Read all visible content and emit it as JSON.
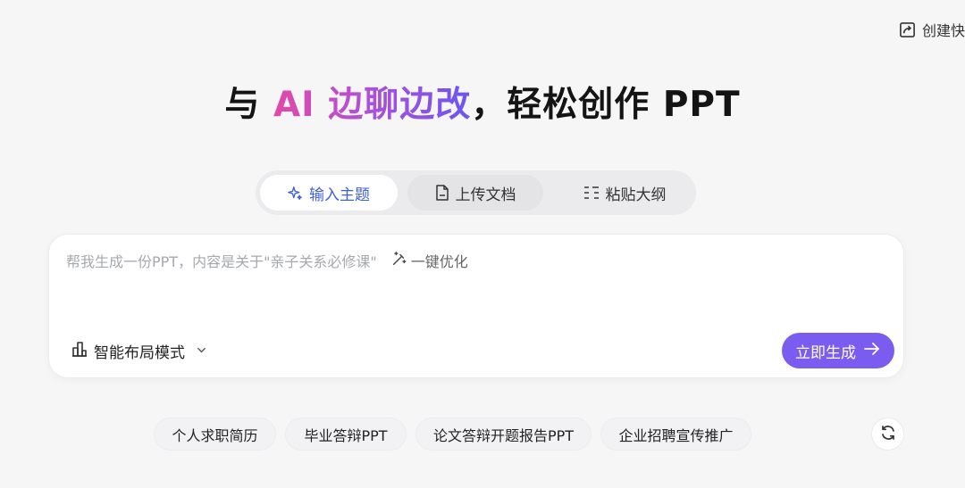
{
  "header": {
    "create_label": "创建快",
    "create_icon": "share-edit-icon"
  },
  "hero": {
    "prefix": "与 ",
    "highlight": "AI 边聊边改",
    "suffix": "，轻松创作 PPT"
  },
  "tabs": [
    {
      "label": "输入主题",
      "icon": "sparkle-icon",
      "active": true
    },
    {
      "label": "上传文档",
      "icon": "document-icon",
      "active": false
    },
    {
      "label": "粘贴大纲",
      "icon": "outline-list-icon",
      "active": false
    }
  ],
  "input": {
    "placeholder": "帮我生成一份PPT，内容是关于\"亲子关系必修课\"",
    "optimize_label": "一键优化",
    "optimize_icon": "magic-wand-icon",
    "mode_label": "智能布局模式",
    "mode_icon": "layout-icon",
    "submit_label": "立即生成",
    "submit_icon": "arrow-right-icon"
  },
  "suggestions": [
    "个人求职简历",
    "毕业答辩PPT",
    "论文答辩开题报告PPT",
    "企业招聘宣传推广"
  ],
  "refresh_icon": "refresh-icon",
  "colors": {
    "accent": "#7a5cf0",
    "active_tab_text": "#3d5fd8",
    "gradient_start": "#e14aa9",
    "gradient_end": "#6a56f2",
    "background": "#f6f6f7"
  }
}
